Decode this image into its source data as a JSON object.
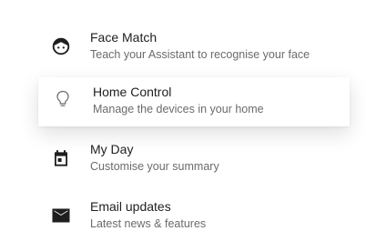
{
  "items": [
    {
      "icon": "face-icon",
      "title": "Face Match",
      "subtitle": "Teach your Assistant to recognise your face"
    },
    {
      "icon": "lightbulb-icon",
      "title": "Home Control",
      "subtitle": "Manage the devices in your home"
    },
    {
      "icon": "calendar-icon",
      "title": "My Day",
      "subtitle": "Customise your summary"
    },
    {
      "icon": "mail-icon",
      "title": "Email updates",
      "subtitle": "Latest news & features"
    }
  ]
}
